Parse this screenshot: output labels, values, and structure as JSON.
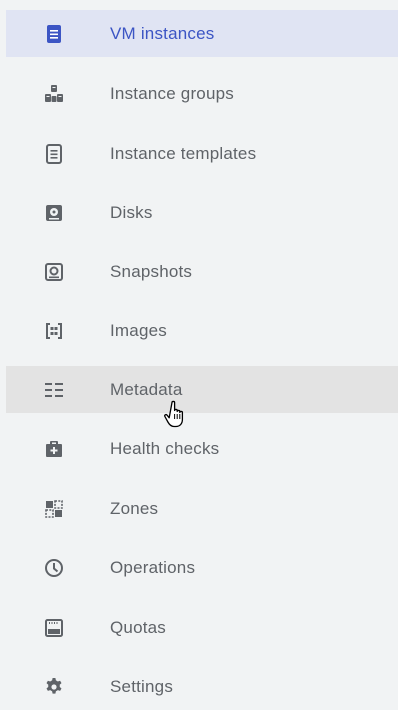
{
  "colors": {
    "background": "#f1f3f4",
    "selected_background": "#e0e4f3",
    "hover_background": "#e3e3e3",
    "accent": "#3c55c4",
    "icon": "#5f6368",
    "text": "#5f6368"
  },
  "nav": {
    "items": [
      {
        "label": "VM instances",
        "icon": "vm-instance-icon",
        "selected": true
      },
      {
        "label": "Instance groups",
        "icon": "instance-groups-icon"
      },
      {
        "label": "Instance templates",
        "icon": "instance-templates-icon"
      },
      {
        "label": "Disks",
        "icon": "disk-icon"
      },
      {
        "label": "Snapshots",
        "icon": "snapshot-icon"
      },
      {
        "label": "Images",
        "icon": "image-icon"
      },
      {
        "label": "Metadata",
        "icon": "metadata-icon",
        "hovered": true
      },
      {
        "label": "Health checks",
        "icon": "health-check-icon"
      },
      {
        "label": "Zones",
        "icon": "zones-icon"
      },
      {
        "label": "Operations",
        "icon": "operations-icon"
      },
      {
        "label": "Quotas",
        "icon": "quotas-icon"
      },
      {
        "label": "Settings",
        "icon": "gear-icon"
      }
    ]
  },
  "cursor": {
    "icon": "hand-pointer-cursor-icon"
  }
}
